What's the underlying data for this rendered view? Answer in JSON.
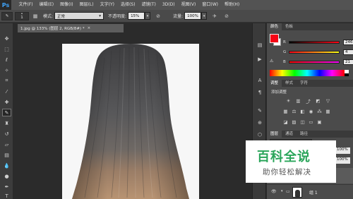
{
  "app": {
    "logo": "Ps"
  },
  "menu": [
    "文件(F)",
    "编辑(E)",
    "图像(I)",
    "图层(L)",
    "文字(Y)",
    "选择(S)",
    "滤镜(T)",
    "3D(D)",
    "视图(V)",
    "窗口(W)",
    "帮助(H)"
  ],
  "options": {
    "brush_size": "1",
    "mode_label": "模式:",
    "mode_value": "正常",
    "opacity_label": "不透明度:",
    "opacity_value": "15%",
    "flow_label": "流量:",
    "flow_value": "100%"
  },
  "document_tab": {
    "title": "1.jpg @ 133% (图层 2, RGB/8#) *",
    "close": "×"
  },
  "color_panel": {
    "tabs": [
      "颜色",
      "色板"
    ],
    "r_label": "R",
    "r_value": "246",
    "g_label": "G",
    "g_value": "4",
    "b_label": "B",
    "b_value": "21",
    "foreground_color": "#f60415"
  },
  "adjustments_panel": {
    "tabs": [
      "调整",
      "样式",
      "字符"
    ],
    "add_label": "添加调整"
  },
  "layers_panel": {
    "tabs": [
      "图层",
      "通道",
      "路径"
    ],
    "opacity_value": "100%",
    "fill_value": "100%",
    "group_name": "组 1"
  },
  "watermark": {
    "title": "百科全说",
    "subtitle": "助你轻松解决"
  },
  "colors": {
    "menubar": "#535353",
    "canvas_bg": "#2b2b2b",
    "accent_logo": "#3fa2f7",
    "watermark_green": "#2aa55a"
  }
}
